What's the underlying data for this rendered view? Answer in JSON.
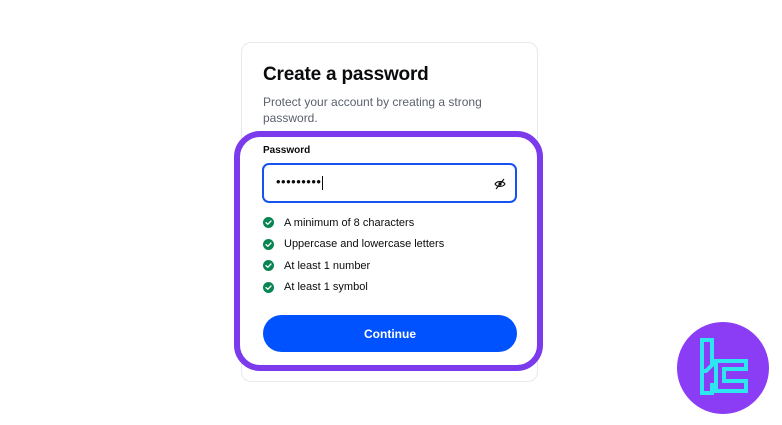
{
  "form": {
    "title": "Create a password",
    "subtitle": "Protect your account by creating a strong password.",
    "password_label": "Password",
    "password_value": "•••••••••",
    "requirements": [
      {
        "label": "A minimum of 8 characters",
        "met": true
      },
      {
        "label": "Uppercase and lowercase letters",
        "met": true
      },
      {
        "label": "At least 1 number",
        "met": true
      },
      {
        "label": "At least 1 symbol",
        "met": true
      }
    ],
    "continue_label": "Continue"
  },
  "icons": {
    "visibility_toggle": "eye-off-icon",
    "requirement_check": "check-circle-icon",
    "brand": "brand-logo"
  },
  "colors": {
    "primary": "#0052ff",
    "field_focus": "#1652f0",
    "success": "#098551",
    "highlight": "#7c3aed",
    "logo_bg": "#8b3df5",
    "logo_mark": "#2ee6f0"
  }
}
